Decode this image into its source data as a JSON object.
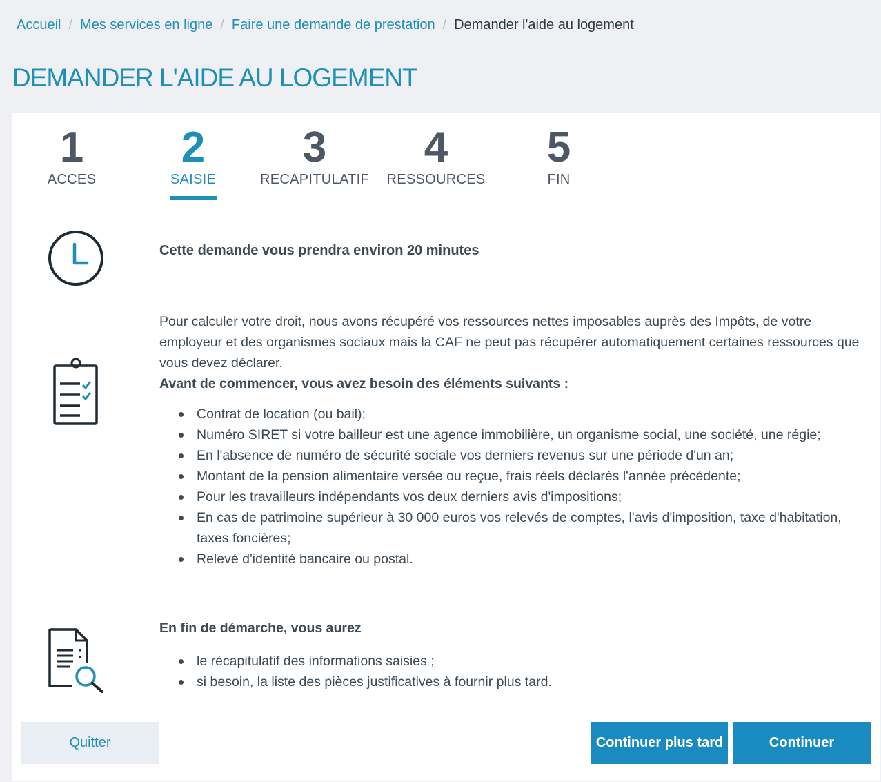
{
  "breadcrumb": {
    "items": [
      "Accueil",
      "Mes services en ligne",
      "Faire une demande de prestation"
    ],
    "current": "Demander l'aide au logement",
    "separator": "/"
  },
  "page": {
    "title": "DEMANDER L'AIDE AU LOGEMENT"
  },
  "steps": [
    {
      "num": "1",
      "label": "ACCES"
    },
    {
      "num": "2",
      "label": "SAISIE"
    },
    {
      "num": "3",
      "label": "RECAPITULATIF"
    },
    {
      "num": "4",
      "label": "RESSOURCES"
    },
    {
      "num": "5",
      "label": "FIN"
    }
  ],
  "active_step": 2,
  "content": {
    "duration": "Cette demande vous prendra environ 20 minutes",
    "intro_paragraph": "Pour calculer votre droit, nous avons récupéré vos ressources nettes imposables auprès des Impôts, de votre employeur et des organismes sociaux mais la CAF ne peut pas récupérer automatiquement certaines ressources que vous devez déclarer.",
    "prerequisites_heading": "Avant de commencer, vous avez besoin des éléments suivants :",
    "prerequisites": [
      "Contrat de location (ou bail);",
      "Numéro SIRET si votre bailleur est une agence immobilière, un organisme social, une société, une régie;",
      "En l'absence de numéro de sécurité sociale vos derniers revenus sur une période d'un an;",
      "Montant de la pension alimentaire versée ou reçue, frais réels déclarés l'année précédente;",
      "Pour les travailleurs indépendants vos deux derniers avis d'impositions;",
      "En cas de patrimoine supérieur à 30 000 euros vos relevés de comptes, l'avis d'imposition, taxe d'habitation, taxes foncières;",
      "Relevé d'identité bancaire ou postal."
    ],
    "end_heading": "En fin de démarche, vous aurez",
    "end_items": [
      "le récapitulatif des informations saisies ;",
      "si besoin, la liste des pièces justificatives à fournir plus tard."
    ]
  },
  "buttons": {
    "quit": "Quitter",
    "continue_later": "Continuer plus tard",
    "continue": "Continuer"
  },
  "colors": {
    "accent": "#1f8fb8",
    "button_primary": "#1a8bc0",
    "button_secondary": "#e9eef5",
    "background": "#eef0f3"
  },
  "icons": {
    "duration": "clock-icon",
    "prerequisites": "clipboard-checklist-icon",
    "end": "document-search-icon"
  }
}
